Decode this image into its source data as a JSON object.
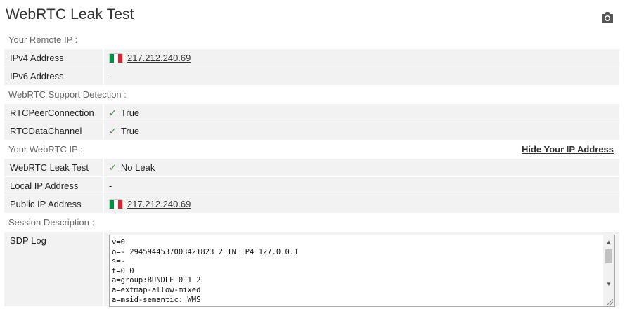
{
  "page": {
    "title": "WebRTC Leak Test"
  },
  "sections": {
    "remote_ip": "Your Remote IP :",
    "support": "WebRTC Support Detection :",
    "webrtc_ip": "Your WebRTC IP :",
    "session": "Session Description :"
  },
  "hide_link": "Hide Your IP Address",
  "rows": {
    "ipv4": {
      "label": "IPv4 Address",
      "value": "217.212.240.69"
    },
    "ipv6": {
      "label": "IPv6 Address",
      "value": "-"
    },
    "peer": {
      "label": "RTCPeerConnection",
      "value": "True"
    },
    "datachannel": {
      "label": "RTCDataChannel",
      "value": "True"
    },
    "leak": {
      "label": "WebRTC Leak Test",
      "value": "No Leak"
    },
    "local_ip": {
      "label": "Local IP Address",
      "value": "-"
    },
    "public_ip": {
      "label": "Public IP Address",
      "value": "217.212.240.69"
    },
    "sdp": {
      "label": "SDP Log"
    }
  },
  "sdp_lines": "v=0\no=- 2945944537003421823 2 IN IP4 127.0.0.1\ns=-\nt=0 0\na=group:BUNDLE 0 1 2\na=extmap-allow-mixed\na=msid-semantic: WMS",
  "icons": {
    "camera": "camera-icon",
    "check": "checkmark-icon",
    "flag": "italy-flag-icon",
    "scroll_up": "arrow-up-icon",
    "scroll_down": "arrow-down-icon",
    "grip": "resize-grip-icon"
  },
  "colors": {
    "check": "#3a8a3a",
    "row_bg": "#f2f2f2",
    "flag_green": "#009246",
    "flag_white": "#ffffff",
    "flag_red": "#ce2b37"
  }
}
